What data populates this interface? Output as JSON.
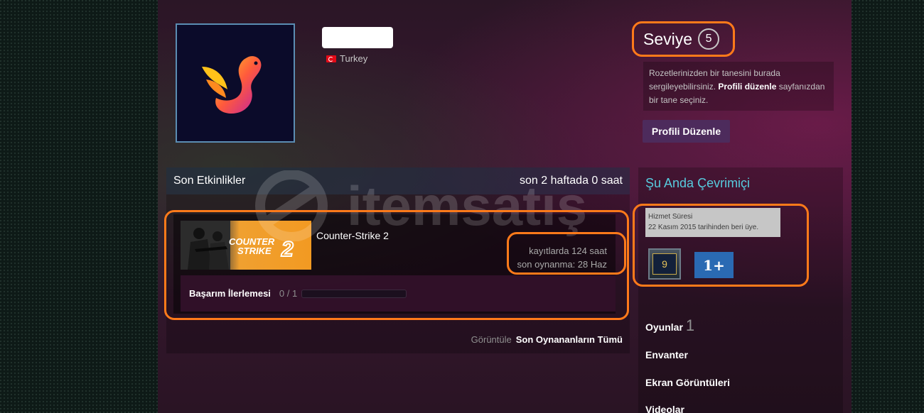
{
  "profile": {
    "country": "Turkey"
  },
  "level": {
    "label": "Seviye",
    "value": "5"
  },
  "badge_note": {
    "text_before": "Rozetlerinizden bir tanesini burada sergileyebilirsiniz. ",
    "link": "Profili düzenle",
    "text_after": " sayfanızdan bir tane seçiniz."
  },
  "edit_profile_button": "Profili Düzenle",
  "activity": {
    "title": "Son Etkinlikler",
    "summary": "son 2 haftada 0 saat",
    "game": {
      "name": "Counter-Strike 2",
      "hours_on_record": "kayıtlarda 124 saat",
      "last_played": "son oynanma: 28 Haz",
      "thumb_text_1": "COUNTER",
      "thumb_text_2": "STRIKE",
      "thumb_text_3": "2",
      "achievement_label": "Başarım İlerlemesi",
      "achievement_count": "0 / 1",
      "achievement_progress": 0
    },
    "footer_prefix": "Görüntüle",
    "footer_link": "Son Oynananların Tümü"
  },
  "right_panel": {
    "online_status": "Şu Anda Çevrimiçi",
    "service_tooltip_title": "Hizmet Süresi",
    "service_tooltip_text": "22 Kasım 2015 tarihinden beri üye.",
    "badge_years": "9",
    "badge_plus": "1+",
    "links": [
      {
        "label": "Oyunlar",
        "count": "1"
      },
      {
        "label": "Envanter"
      },
      {
        "label": "Ekran Görüntüleri"
      },
      {
        "label": "Videolar"
      }
    ]
  },
  "watermark": "itemsatış",
  "colors": {
    "accent_online": "#57cbde",
    "highlight": "#ff7a1a",
    "edit_button": "#4d2b5c"
  }
}
